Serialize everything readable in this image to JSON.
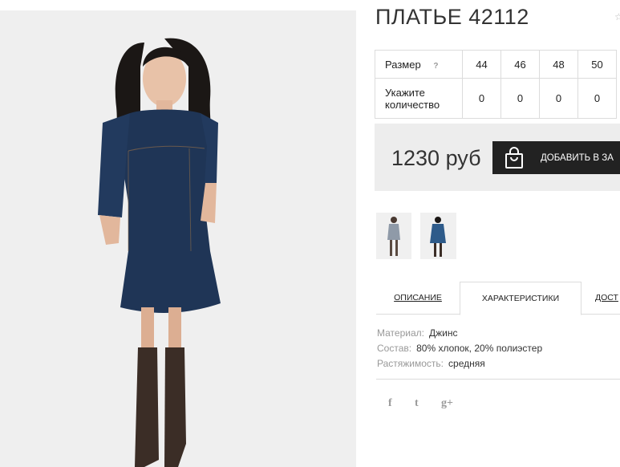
{
  "product": {
    "title": "ПЛАТЬЕ 42112",
    "price": "1230 руб",
    "add_to_cart_label": "ДОБАВИТЬ В ЗА",
    "colors": {
      "denim": "#1f3556",
      "boots": "#3b2d26",
      "button": "#222222"
    }
  },
  "sizes": {
    "size_label": "Размер",
    "help_label": "?",
    "qty_label": "Укажите количество",
    "values": [
      "44",
      "46",
      "48",
      "50"
    ],
    "quantities": [
      "0",
      "0",
      "0",
      "0"
    ]
  },
  "tabs": [
    "ОПИСАНИЕ",
    "ХАРАКТЕРИСТИКИ",
    "ДОСТ"
  ],
  "specs": [
    {
      "key": "Материал:",
      "value": "Джинс"
    },
    {
      "key": "Состав:",
      "value": "80% хлопок, 20% полиэстер"
    },
    {
      "key": "Растяжимость:",
      "value": "средняя"
    }
  ],
  "social": [
    "f",
    "t",
    "g+"
  ],
  "icons": {
    "wishlist": "star-icon",
    "cart": "shopping-bag-icon"
  }
}
